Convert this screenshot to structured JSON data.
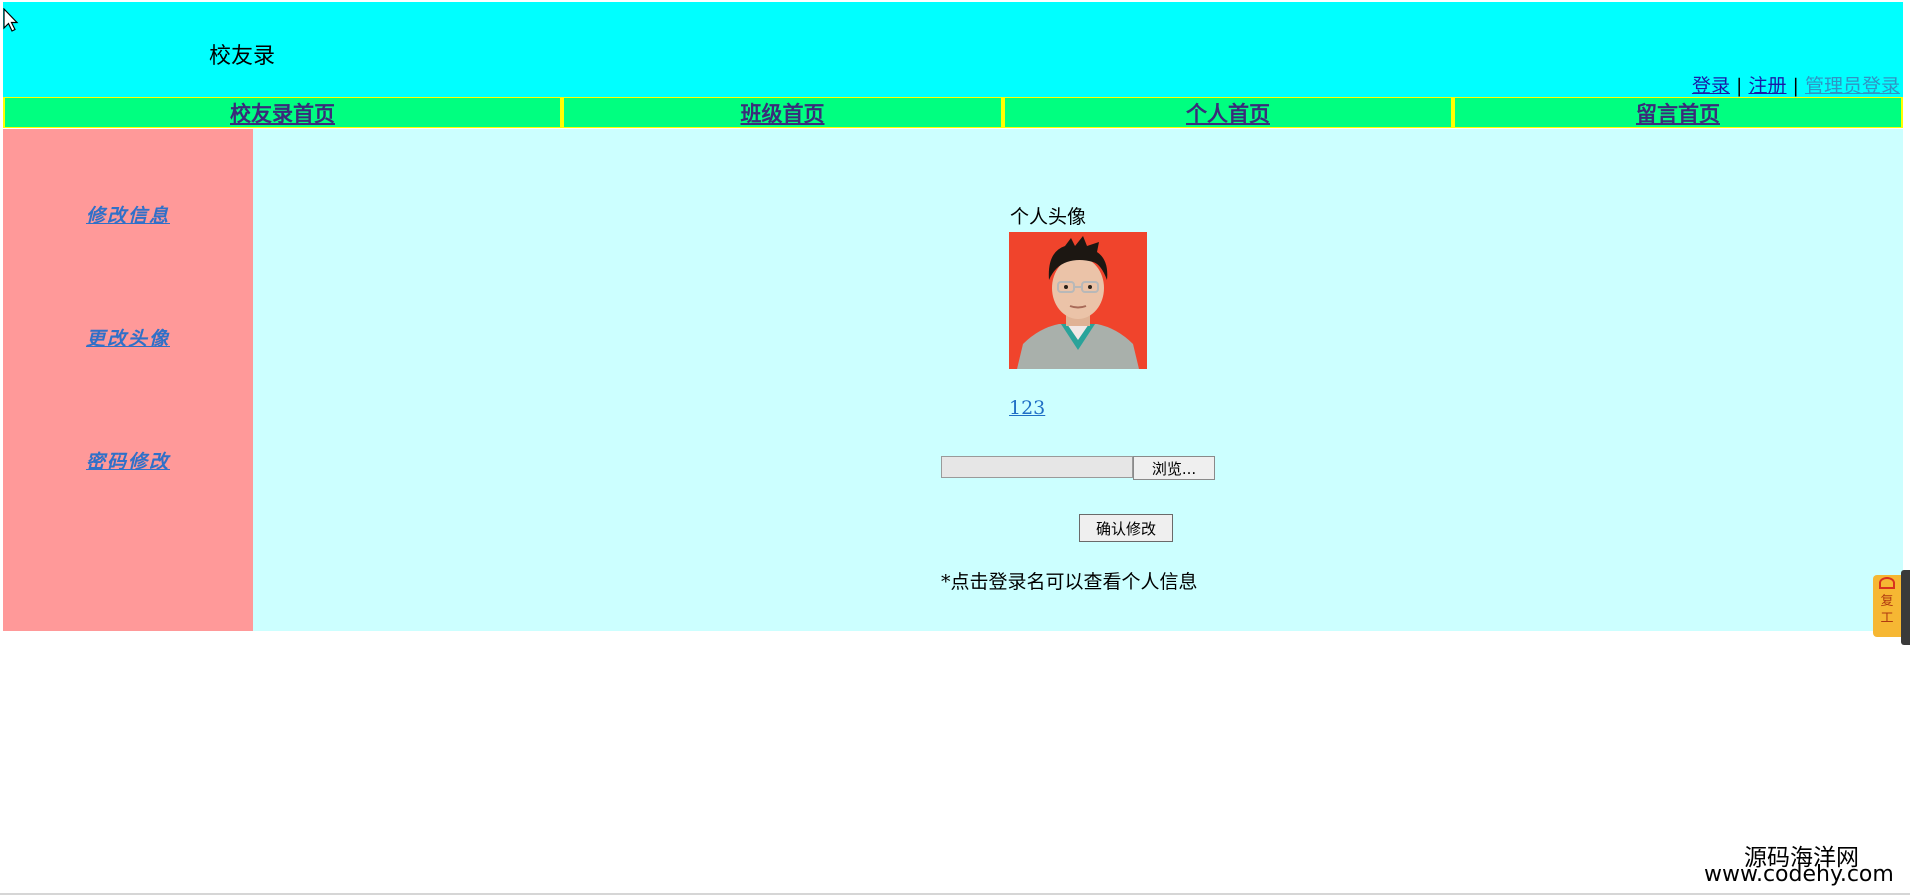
{
  "header": {
    "site_title": "校友录",
    "links": {
      "login": "登录",
      "register": "注册",
      "admin_login": "管理员登录",
      "separator": "|"
    },
    "bg_color": "#00ffff"
  },
  "nav": {
    "items": [
      {
        "label": "校友录首页"
      },
      {
        "label": "班级首页"
      },
      {
        "label": "个人首页"
      },
      {
        "label": "留言首页"
      }
    ],
    "bg_color": "#00ff80",
    "border_color": "#ffff00"
  },
  "sidebar": {
    "items": [
      {
        "label": "修改信息"
      },
      {
        "label": "更改头像"
      },
      {
        "label": "密码修改"
      }
    ],
    "bg_color": "#ff9999"
  },
  "main": {
    "avatar_label": "个人头像",
    "username": "123",
    "file_input": {
      "value": "",
      "browse_label": "浏览..."
    },
    "confirm_label": "确认修改",
    "hint": "*点击登录名可以查看个人信息",
    "bg_color": "#ccffff"
  },
  "float_widget": {
    "text_line1": "复",
    "text_line2": "工"
  },
  "watermark": {
    "name": "源码海洋网",
    "url": "www.codehy.com"
  }
}
